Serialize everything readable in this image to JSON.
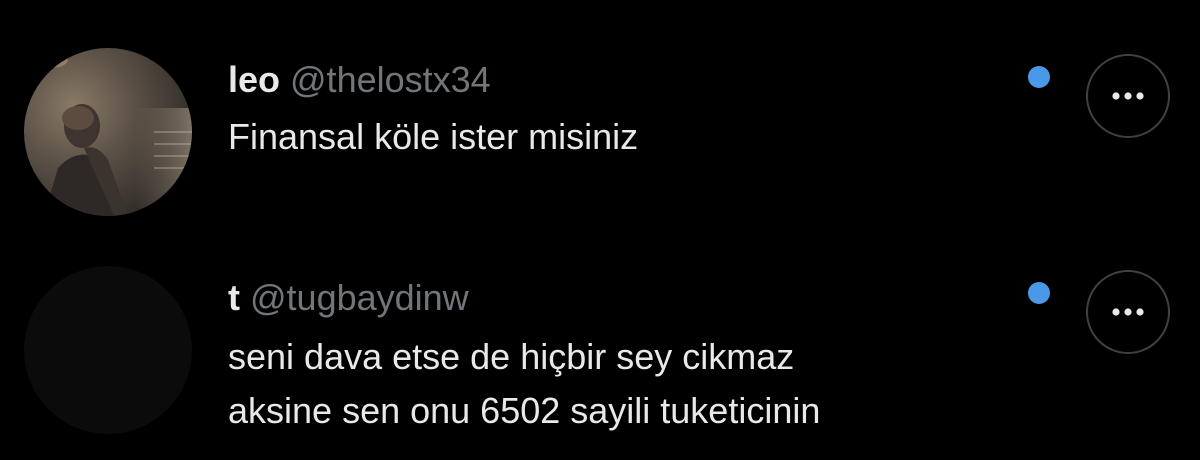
{
  "colors": {
    "background": "#000000",
    "primary_text": "#e7e9ea",
    "secondary_text": "#71767b",
    "accent_blue": "#1d9bf0",
    "unread_dot": "#4a99e9"
  },
  "tweets": [
    {
      "display_name": "leo",
      "handle": "@thelostx34",
      "text_lines": [
        "Finansal köle ister misiniz"
      ],
      "unread_indicator": true,
      "more_icon": "more-horizontal-icon"
    },
    {
      "display_name": "t",
      "handle": "@tugbaydinw",
      "text_lines": [
        "seni dava etse de hiçbir sey cikmaz",
        "aksine sen onu 6502 sayili tuketicinin"
      ],
      "unread_indicator": true,
      "more_icon": "more-horizontal-icon"
    }
  ]
}
